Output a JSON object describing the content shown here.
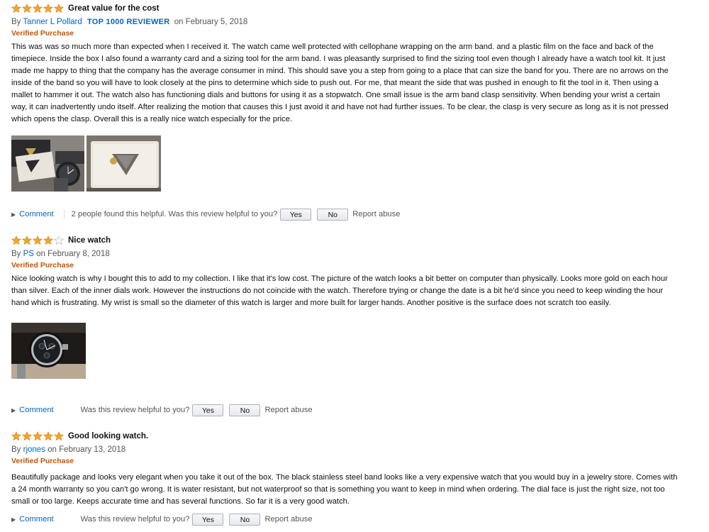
{
  "colors": {
    "star": "#f8a622",
    "link": "#0066c0",
    "verified": "#c45500"
  },
  "reviews": [
    {
      "rating": 5,
      "title": "Great value for the cost",
      "by": "By",
      "author": "Tanner L Pollard",
      "badge": "TOP 1000 REVIEWER",
      "date": "on February 5, 2018",
      "verified": "Verified Purchase",
      "body": "This was was so much more than expected when I received it. The watch came well protected with cellophane wrapping on the arm band. and a plastic film on the face and back of the timepiece. Inside the box I also found a warranty card and a sizing tool for the arm band. I was pleasantly surprised to find the sizing tool even though I already have a watch tool kit. It just made me happy to thing that the company has the average consumer in mind. This should save you a step from going to a place that can size the band for you. There are no arrows on the inside of the band so you will have to look closely at the pins to determine which side to push out. For me, that meant the side that was pushed in enough to fit the tool in it. Then using a mallet to hammer it out. The watch also has functioning dials and buttons for using it as a stopwatch. One small issue is the arm band clasp sensitivity. When bending your wrist a certain way, it can inadvertently undo itself. After realizing the motion that causes this I just avoid it and have not had further issues. To be clear, the clasp is very secure as long as it is not pressed which opens the clasp. Overall this is a really nice watch especially for the price.",
      "images": [
        "watch-and-box-photo",
        "watch-box-lid-photo"
      ],
      "comment": "Comment",
      "helpful_text": "2 people found this helpful. Was this review helpful to you?",
      "yes": "Yes",
      "no": "No",
      "report": "Report abuse"
    },
    {
      "rating": 4,
      "title": "Nice watch",
      "by": "By",
      "author": "PS",
      "date": "on February 8, 2018",
      "verified": "Verified Purchase",
      "body": "Nice looking watch is why I bought this to add to my collection. I like that it's low cost. The picture of the watch looks a bit better on computer than physically. Looks more gold on each hour than silver. Each of the inner dials work. However the instructions do not coincide with the watch. Therefore trying or change the date is a bit he'd since you need to keep winding the hour hand which is frustrating. My wrist is small so the diameter of this watch is larger and more built for larger hands. Another positive is the surface does not scratch too easily.",
      "images": [
        "watch-on-wrist-photo"
      ],
      "comment": "Comment",
      "helpful_text": "Was this review helpful to you?",
      "yes": "Yes",
      "no": "No",
      "report": "Report abuse"
    },
    {
      "rating": 5,
      "title": "Good looking watch.",
      "by": "By",
      "author": "rjones",
      "date": "on February 13, 2018",
      "verified": "Verified Purchase",
      "body": "Beautifully package and looks very elegant when you take it out of the box. The black stainless steel band looks like a very expensive watch that you would buy in a jewelry store. Comes with a 24 month warranty so you can't go wrong. It is water resistant, but not waterproof so that is something you want to keep in mind when ordering. The dial face is just the right size, not too small or too large. Keeps accurate time and has several functions. So far it is a very good watch.",
      "images": [],
      "comment": "Comment",
      "helpful_text": "Was this review helpful to you?",
      "yes": "Yes",
      "no": "No",
      "report": "Report abuse"
    }
  ]
}
